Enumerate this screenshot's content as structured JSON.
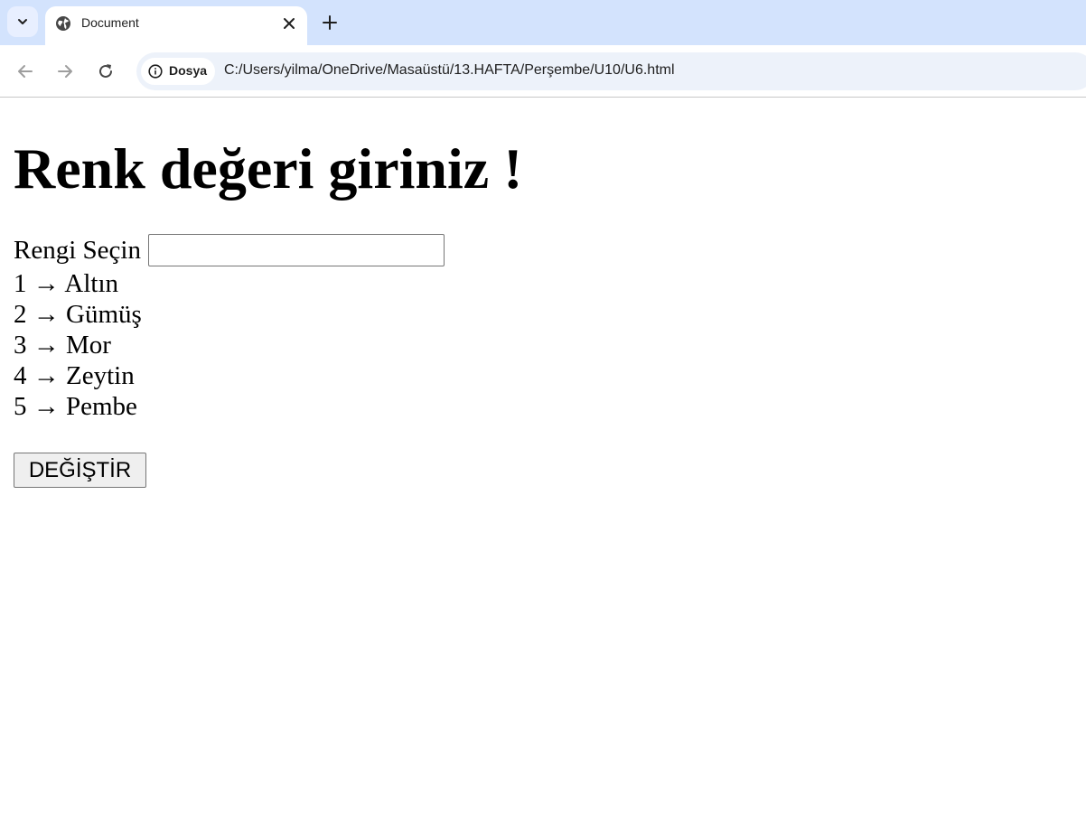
{
  "browser": {
    "tab": {
      "title": "Document"
    },
    "site_chip": "Dosya",
    "url": "C:/Users/yilma/OneDrive/Masaüstü/13.HAFTA/Perşembe/U10/U6.html"
  },
  "page": {
    "heading": "Renk değeri giriniz !",
    "input_label": "Rengi Seçin",
    "input_value": "",
    "options": [
      {
        "text": "1 → Altın"
      },
      {
        "text": "2 → Gümüş"
      },
      {
        "text": "3 → Mor"
      },
      {
        "text": "4 → Zeytin"
      },
      {
        "text": "5 → Pembe"
      }
    ],
    "button_label": "DEĞİŞTİR"
  },
  "colors": {
    "tabstrip": "#d3e3fd",
    "omnibox": "#edf2fa",
    "icon": "#474747"
  }
}
